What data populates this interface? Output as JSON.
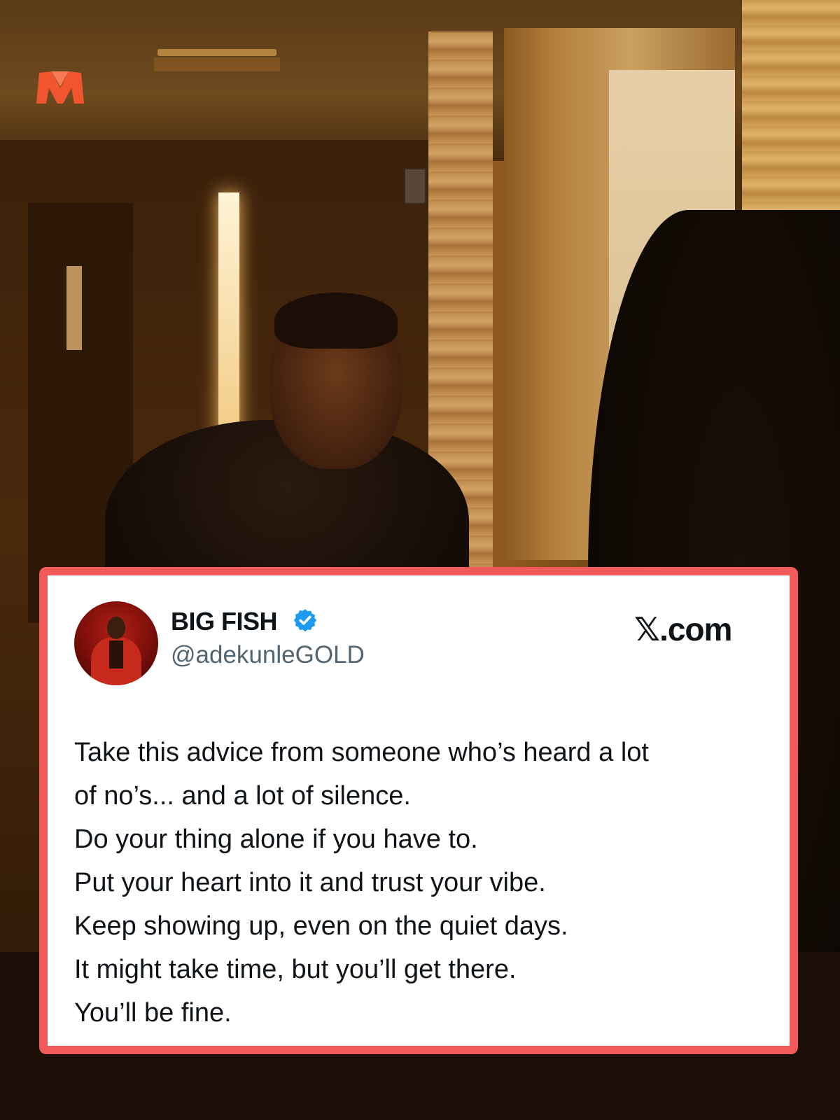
{
  "brand": {
    "logo_icon": "brand-logo-icon",
    "color": "#f0552f"
  },
  "tweet": {
    "name": "BIG FISH",
    "verified_icon": "verified-badge-icon",
    "handle": "@adekunleGOLD",
    "source_prefix": "𝕏",
    "source_suffix": ".com",
    "lines": [
      "Take this advice from someone who’s heard a lot",
      "of no’s... and a lot of silence.",
      "Do your thing alone if you have to.",
      "Put your heart into it and trust your vibe.",
      "Keep showing up, even on the quiet days.",
      "It might take time, but you’ll get there.",
      "You’ll be fine."
    ]
  },
  "colors": {
    "card_border": "#f25a5a",
    "card_background": "#ffffff",
    "verified_blue": "#1d9bf0",
    "text_primary": "#0f1419",
    "text_secondary": "#536471"
  }
}
